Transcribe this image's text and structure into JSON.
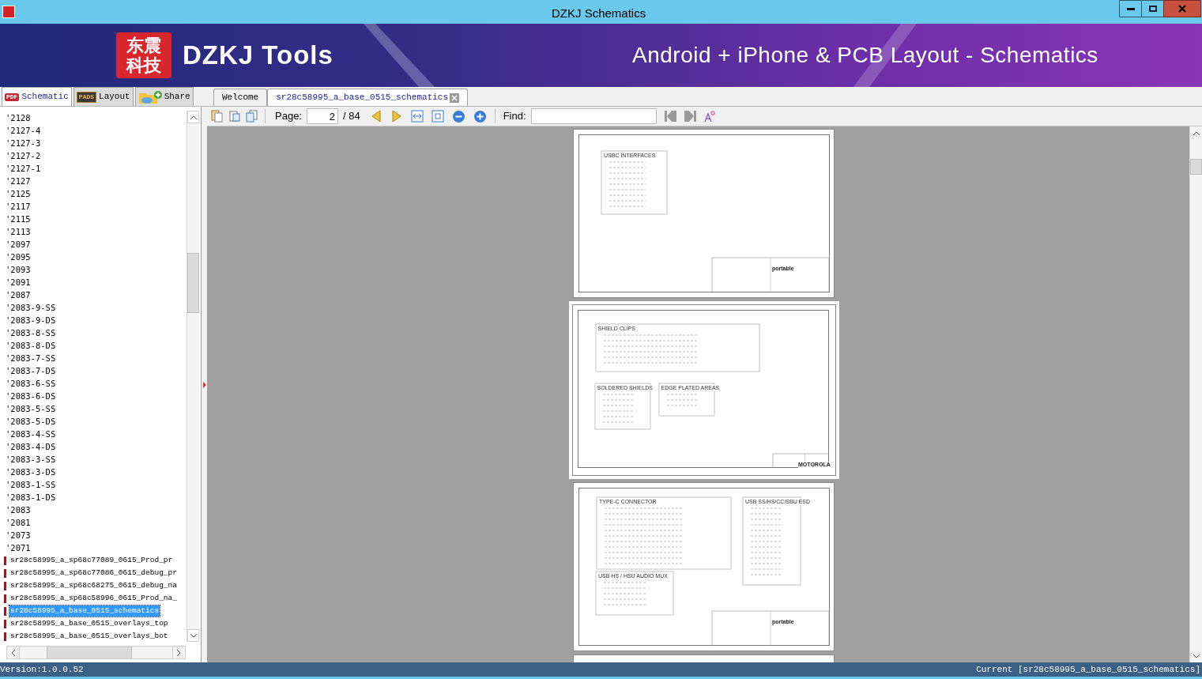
{
  "window": {
    "title": "DZKJ Schematics"
  },
  "banner": {
    "logo_lines": [
      "东震",
      "科技"
    ],
    "brand": "DZKJ Tools",
    "tagline": "Android + iPhone & PCB Layout - Schematics"
  },
  "side_tabs": [
    {
      "label": "Schematic",
      "kind": "pdf",
      "icon_text": "PDF",
      "selected": true
    },
    {
      "label": "Layout",
      "kind": "pads",
      "icon_text": "PADS",
      "selected": false
    },
    {
      "label": "Share",
      "kind": "share",
      "selected": false
    }
  ],
  "doc_tabs": [
    {
      "label": "Welcome",
      "selected": false,
      "closable": false
    },
    {
      "label": "sr28c58995_a_base_0515_schematics",
      "selected": true,
      "closable": true
    }
  ],
  "file_list": [
    {
      "label": "'2128",
      "kind": "folder",
      "selected": false
    },
    {
      "label": "'2127-4",
      "kind": "folder",
      "selected": false
    },
    {
      "label": "'2127-3",
      "kind": "folder",
      "selected": false
    },
    {
      "label": "'2127-2",
      "kind": "folder",
      "selected": false
    },
    {
      "label": "'2127-1",
      "kind": "folder",
      "selected": false
    },
    {
      "label": "'2127",
      "kind": "folder",
      "selected": false
    },
    {
      "label": "'2125",
      "kind": "folder",
      "selected": false
    },
    {
      "label": "'2117",
      "kind": "folder",
      "selected": false
    },
    {
      "label": "'2115",
      "kind": "folder",
      "selected": false
    },
    {
      "label": "'2113",
      "kind": "folder",
      "selected": false
    },
    {
      "label": "'2097",
      "kind": "folder",
      "selected": false
    },
    {
      "label": "'2095",
      "kind": "folder",
      "selected": false
    },
    {
      "label": "'2093",
      "kind": "folder",
      "selected": false
    },
    {
      "label": "'2091",
      "kind": "folder",
      "selected": false
    },
    {
      "label": "'2087",
      "kind": "folder",
      "selected": false
    },
    {
      "label": "'2083-9-SS",
      "kind": "folder",
      "selected": false
    },
    {
      "label": "'2083-9-DS",
      "kind": "folder",
      "selected": false
    },
    {
      "label": "'2083-8-SS",
      "kind": "folder",
      "selected": false
    },
    {
      "label": "'2083-8-DS",
      "kind": "folder",
      "selected": false
    },
    {
      "label": "'2083-7-SS",
      "kind": "folder",
      "selected": false
    },
    {
      "label": "'2083-7-DS",
      "kind": "folder",
      "selected": false
    },
    {
      "label": "'2083-6-SS",
      "kind": "folder",
      "selected": false
    },
    {
      "label": "'2083-6-DS",
      "kind": "folder",
      "selected": false
    },
    {
      "label": "'2083-5-SS",
      "kind": "folder",
      "selected": false
    },
    {
      "label": "'2083-5-DS",
      "kind": "folder",
      "selected": false
    },
    {
      "label": "'2083-4-SS",
      "kind": "folder",
      "selected": false
    },
    {
      "label": "'2083-4-DS",
      "kind": "folder",
      "selected": false
    },
    {
      "label": "'2083-3-SS",
      "kind": "folder",
      "selected": false
    },
    {
      "label": "'2083-3-DS",
      "kind": "folder",
      "selected": false
    },
    {
      "label": "'2083-1-SS",
      "kind": "folder",
      "selected": false
    },
    {
      "label": "'2083-1-DS",
      "kind": "folder",
      "selected": false
    },
    {
      "label": "'2083",
      "kind": "folder",
      "selected": false
    },
    {
      "label": "'2081",
      "kind": "folder",
      "selected": false
    },
    {
      "label": "'2073",
      "kind": "folder",
      "selected": false
    },
    {
      "label": "'2071",
      "kind": "folder",
      "selected": false
    },
    {
      "label": "sr28c58995_a_sp68c77089_0615_Prod_pr",
      "kind": "file",
      "selected": false
    },
    {
      "label": "sr28c58995_a_sp68c77086_0615_debug_pr",
      "kind": "file",
      "selected": false
    },
    {
      "label": "sr28c58995_a_sp68c68275_0615_debug_na",
      "kind": "file",
      "selected": false
    },
    {
      "label": "sr28c58995_a_sp68c58996_0615_Prod_na_",
      "kind": "file",
      "selected": false
    },
    {
      "label": "sr28c58995_a_base_0515_schematics",
      "kind": "file",
      "selected": true
    },
    {
      "label": "sr28c58995_a_base_0515_overlays_top",
      "kind": "file",
      "selected": false
    },
    {
      "label": "sr28c58995_a_base_0515_overlays_bot",
      "kind": "file",
      "selected": false
    }
  ],
  "toolbar": {
    "page_label": "Page:",
    "page_value": "2",
    "page_total": "/ 84",
    "find_label": "Find:"
  },
  "pages": [
    {
      "selected": false,
      "blocks": [
        "USBC INTERFACES"
      ],
      "title_block": "portable"
    },
    {
      "selected": true,
      "blocks": [
        "SHIELD CLIPS",
        "SOLDERED SHIELDS",
        "EDGE PLATED AREAS"
      ],
      "title_block": "MOTOROLA"
    },
    {
      "selected": false,
      "blocks": [
        "TYPE-C CONNECTOR",
        "USB SS/HS/CC/SBU ESD",
        "USB HS / HSU AUDIO MUX"
      ],
      "title_block": "portable"
    }
  ],
  "status_bar": {
    "version": "Version:1.0.0.52",
    "current": "Current [sr28c58995_a_base_0515_schematics]"
  }
}
